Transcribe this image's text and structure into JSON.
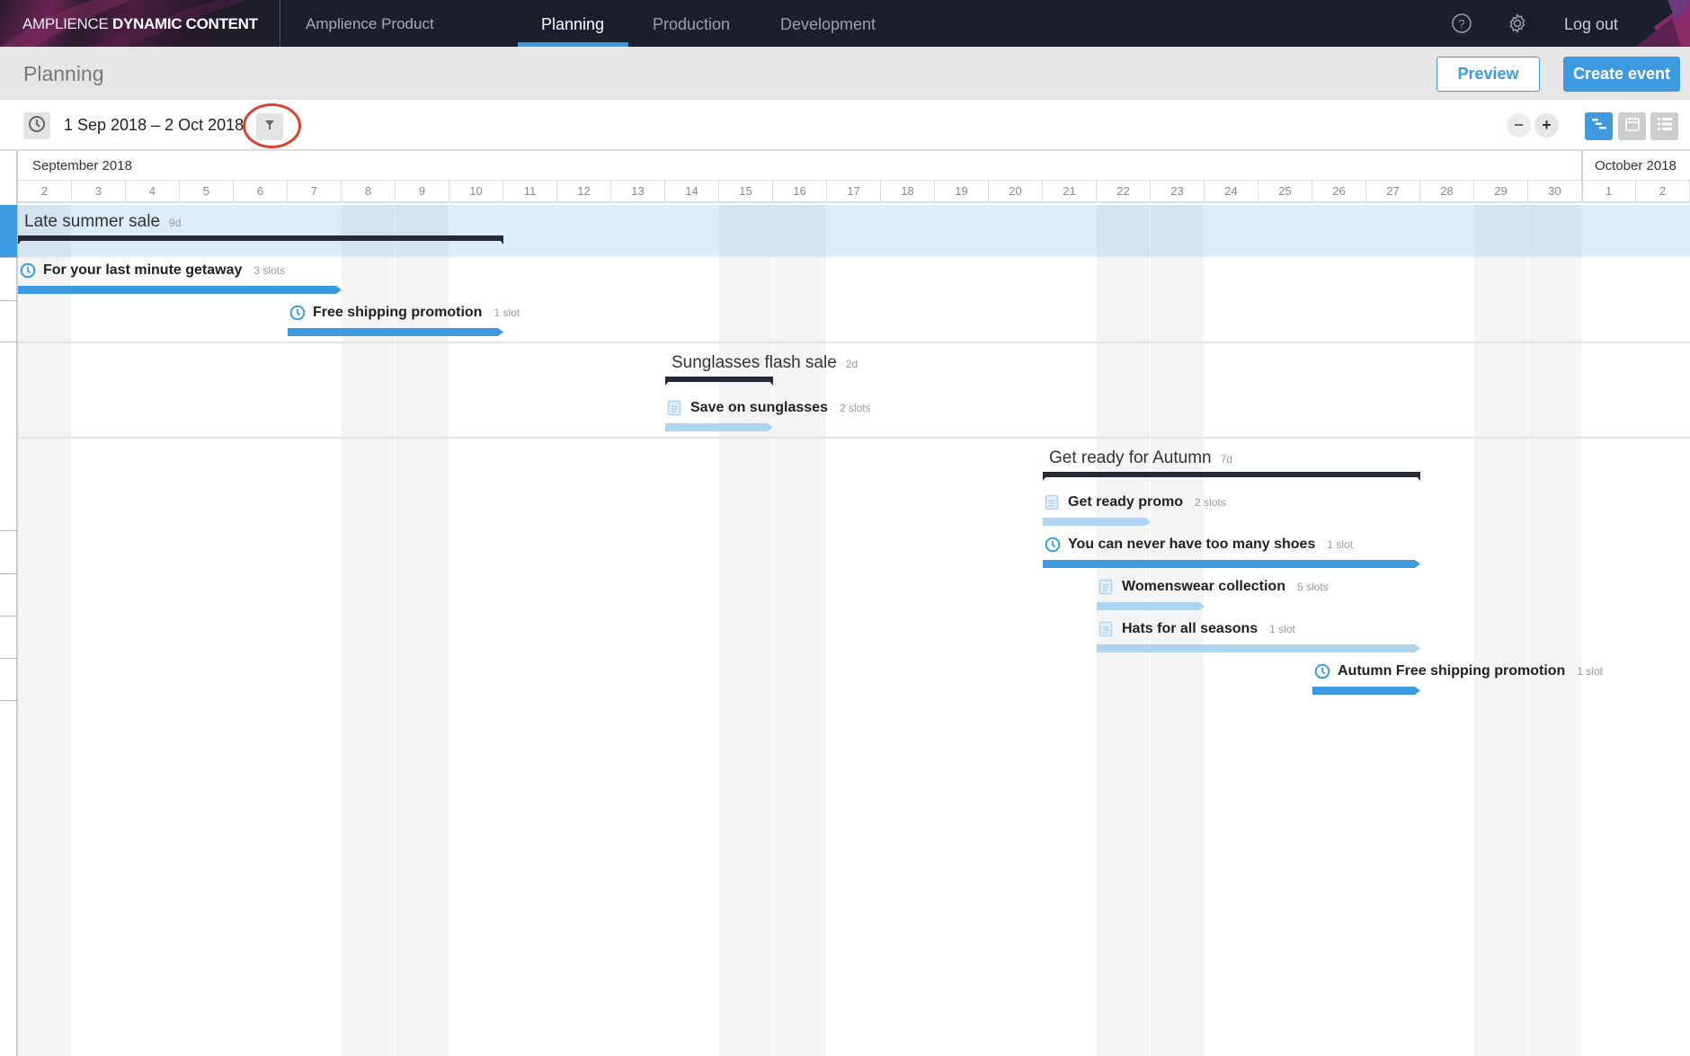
{
  "header": {
    "brand_light": "AMPLIENCE",
    "brand_bold": "DYNAMIC CONTENT",
    "product": "Amplience Product",
    "tabs": [
      {
        "label": "Planning",
        "active": true
      },
      {
        "label": "Production",
        "active": false
      },
      {
        "label": "Development",
        "active": false
      }
    ],
    "help_icon": "help-circle-icon",
    "settings_icon": "gear-icon",
    "logout_label": "Log out"
  },
  "subheader": {
    "title": "Planning",
    "preview_label": "Preview",
    "create_label": "Create event"
  },
  "toolbar": {
    "date_range": "1 Sep 2018 – 2 Oct 2018",
    "zoom_out": "−",
    "zoom_in": "+",
    "views": [
      "timeline",
      "calendar",
      "list"
    ],
    "active_view": "timeline"
  },
  "calendar": {
    "months": [
      {
        "label": "September 2018",
        "start_index": 0
      },
      {
        "label": "October 2018",
        "start_index": 29
      }
    ],
    "days": [
      "2",
      "3",
      "4",
      "5",
      "6",
      "7",
      "8",
      "9",
      "10",
      "11",
      "12",
      "13",
      "14",
      "15",
      "16",
      "17",
      "18",
      "19",
      "20",
      "21",
      "22",
      "23",
      "24",
      "25",
      "26",
      "27",
      "28",
      "29",
      "30",
      "1",
      "2"
    ],
    "weekend_indices": [
      0,
      6,
      7,
      13,
      14,
      20,
      21,
      27,
      28
    ]
  },
  "events": [
    {
      "title": "Late summer sale",
      "duration": "9d",
      "start": 0,
      "end": 9,
      "selected": true,
      "items": [
        {
          "label": "For your last minute getaway",
          "slots": "3 slots",
          "status": "scheduled",
          "start": 0,
          "end": 6
        },
        {
          "label": "Free shipping promotion",
          "slots": "1 slot",
          "status": "scheduled",
          "start": 5,
          "end": 9
        }
      ]
    },
    {
      "title": "Sunglasses flash sale",
      "duration": "2d",
      "start": 12,
      "end": 14,
      "selected": false,
      "items": [
        {
          "label": "Save on sunglasses",
          "slots": "2 slots",
          "status": "draft",
          "start": 12,
          "end": 14
        }
      ]
    },
    {
      "title": "Get ready for Autumn",
      "duration": "7d",
      "start": 19,
      "end": 26,
      "selected": false,
      "items": [
        {
          "label": "Get ready promo",
          "slots": "2 slots",
          "status": "draft",
          "start": 19,
          "end": 21
        },
        {
          "label": "You can never have too many shoes",
          "slots": "1 slot",
          "status": "scheduled",
          "start": 19,
          "end": 26
        },
        {
          "label": "Womenswear collection",
          "slots": "5 slots",
          "status": "draft",
          "start": 20,
          "end": 22
        },
        {
          "label": "Hats for all seasons",
          "slots": "1 slot",
          "status": "draft",
          "start": 20,
          "end": 26
        },
        {
          "label": "Autumn Free shipping promotion",
          "slots": "1 slot",
          "status": "scheduled",
          "start": 24,
          "end": 26
        }
      ]
    }
  ],
  "colors": {
    "accent": "#3d9ae0",
    "draft": "#aed3ee",
    "header_bg": "#1b1f2b",
    "annotation": "#d9432f"
  }
}
